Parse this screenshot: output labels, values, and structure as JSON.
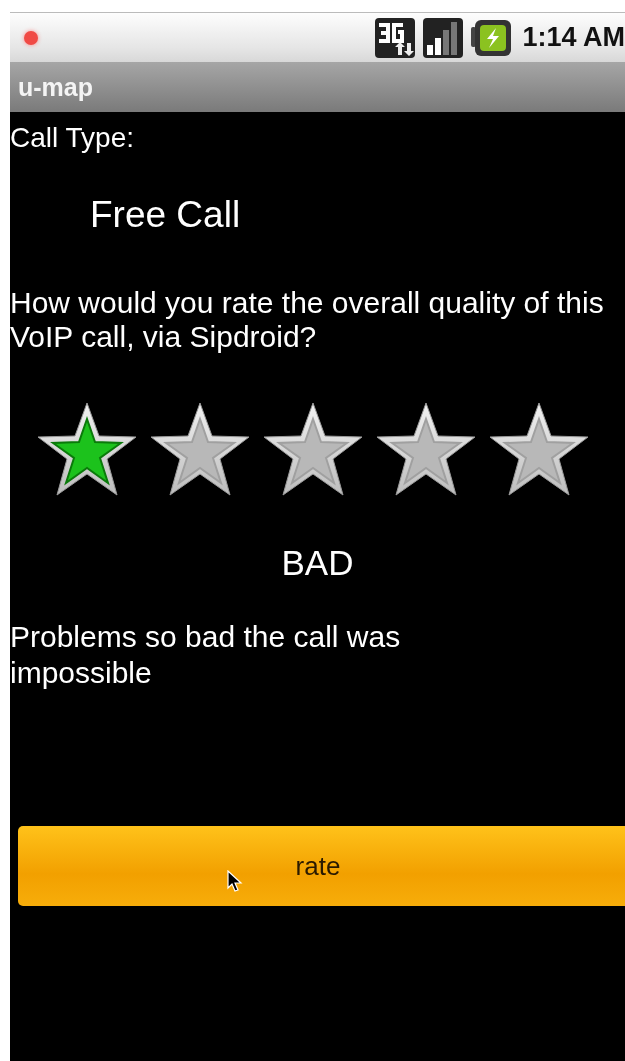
{
  "status_bar": {
    "time": "1:14 AM"
  },
  "title_bar": {
    "title": "u-map"
  },
  "call_type": {
    "label": "Call Type:",
    "value": "Free Call"
  },
  "question": "How would you rate the overall quality of this VoIP call, via Sipdroid?",
  "rating": {
    "stars": 1,
    "verdict": "BAD",
    "description": "Problems so bad the call was impossible"
  },
  "button": {
    "label": "rate"
  }
}
